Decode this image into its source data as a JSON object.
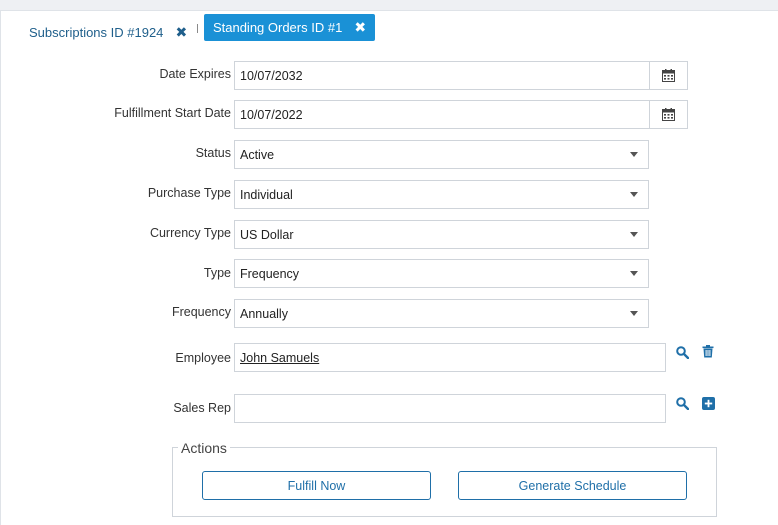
{
  "tabs": [
    {
      "label": "Subscriptions ID #1924",
      "active": false
    },
    {
      "label": "Standing Orders ID #1",
      "active": true
    }
  ],
  "form": {
    "date_expires": {
      "label": "Date Expires",
      "value": "10/07/2032"
    },
    "fulfillment_start_date": {
      "label": "Fulfillment Start Date",
      "value": "10/07/2022"
    },
    "status": {
      "label": "Status",
      "value": "Active"
    },
    "purchase_type": {
      "label": "Purchase Type",
      "value": "Individual"
    },
    "currency_type": {
      "label": "Currency Type",
      "value": "US Dollar"
    },
    "type": {
      "label": "Type",
      "value": "Frequency"
    },
    "frequency": {
      "label": "Frequency",
      "value": "Annually"
    },
    "employee": {
      "label": "Employee",
      "value": "John Samuels"
    },
    "sales_rep": {
      "label": "Sales Rep",
      "value": ""
    }
  },
  "actions": {
    "legend": "Actions",
    "fulfill_now": "Fulfill Now",
    "generate_schedule": "Generate Schedule"
  },
  "icons": {
    "calendar": "calendar-icon",
    "search": "search-icon",
    "trash": "trash-icon",
    "add": "plus-square-icon",
    "close": "close-icon"
  },
  "colors": {
    "accent": "#1a91d6",
    "link": "#1f5f8b",
    "button_border": "#1f6fa8"
  }
}
